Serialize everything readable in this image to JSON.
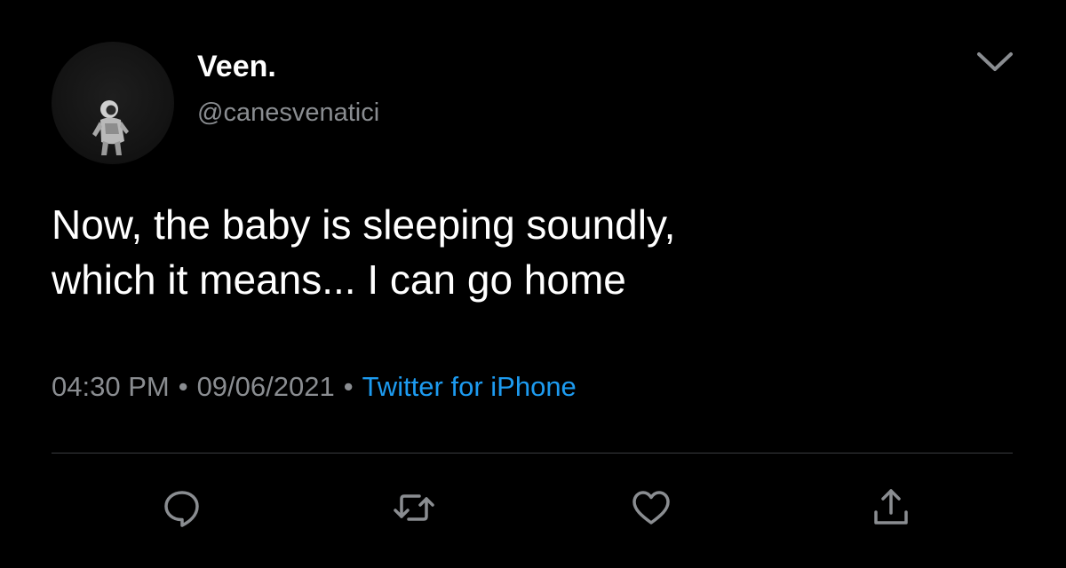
{
  "tweet": {
    "author": {
      "display_name": "Veen.",
      "handle": "@canesvenatici"
    },
    "text": "Now, the baby is sleeping soundly,\nwhich it means... I can go home",
    "meta": {
      "time": "04:30 PM",
      "date": "09/06/2021",
      "separator": "•",
      "source": "Twitter for iPhone"
    },
    "actions": [
      {
        "name": "reply",
        "icon": "speech-bubble-icon"
      },
      {
        "name": "retweet",
        "icon": "retweet-arrows-icon"
      },
      {
        "name": "like",
        "icon": "heart-icon"
      },
      {
        "name": "share",
        "icon": "share-upload-icon"
      }
    ]
  },
  "colors": {
    "background": "#000000",
    "text_primary": "#ffffff",
    "text_secondary": "#8a8d91",
    "link": "#1d9bf0",
    "divider": "#3a3c40",
    "icon": "#8a8d91"
  }
}
